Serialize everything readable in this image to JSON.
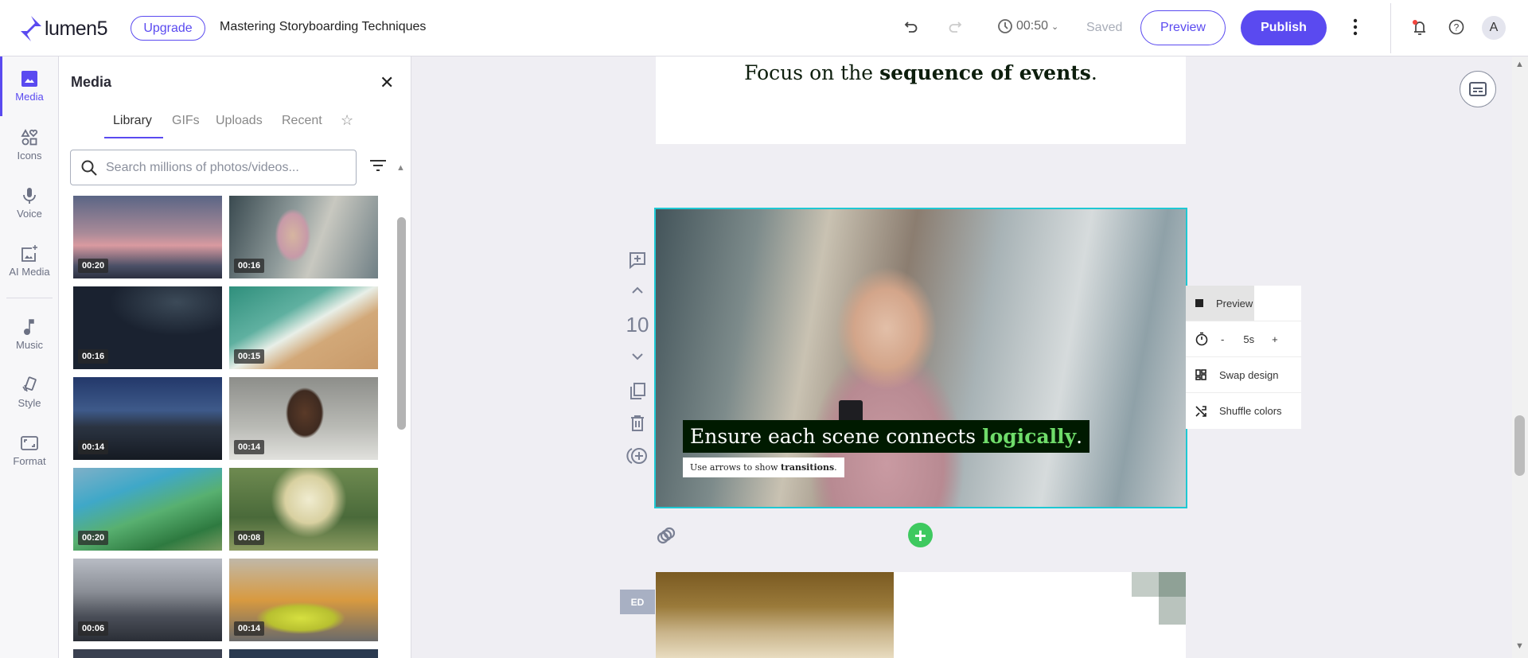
{
  "header": {
    "logo_text": "lumen5",
    "upgrade_label": "Upgrade",
    "project_title": "Mastering Storyboarding Techniques",
    "duration": "00:50",
    "save_status": "Saved",
    "preview_label": "Preview",
    "publish_label": "Publish",
    "avatar_initial": "A"
  },
  "rail": {
    "items": [
      {
        "label": "Media",
        "icon": "image-icon"
      },
      {
        "label": "Icons",
        "icon": "shapes-icon"
      },
      {
        "label": "Voice",
        "icon": "microphone-icon"
      },
      {
        "label": "AI Media",
        "icon": "ai-image-icon"
      },
      {
        "label": "Music",
        "icon": "music-note-icon"
      },
      {
        "label": "Style",
        "icon": "style-icon"
      },
      {
        "label": "Format",
        "icon": "format-icon"
      }
    ]
  },
  "panel": {
    "title": "Media",
    "tabs": [
      "Library",
      "GIFs",
      "Uploads",
      "Recent"
    ],
    "search_placeholder": "Search millions of photos/videos...",
    "thumbnails": [
      {
        "duration": "00:20"
      },
      {
        "duration": "00:16"
      },
      {
        "duration": "00:16"
      },
      {
        "duration": "00:15"
      },
      {
        "duration": "00:14"
      },
      {
        "duration": "00:14"
      },
      {
        "duration": "00:20"
      },
      {
        "duration": "00:08"
      },
      {
        "duration": "00:06"
      },
      {
        "duration": "00:14"
      }
    ]
  },
  "scenes": {
    "prev_text_plain": "Focus on the ",
    "prev_text_bold": "sequence of events",
    "prev_text_end": ".",
    "current_number": "10",
    "caption_plain": "Ensure each scene connects ",
    "caption_highlight": "logically",
    "caption_end": ".",
    "sub_plain": "Use arrows to show ",
    "sub_bold": "transitions",
    "sub_end": ".",
    "next_badge": "ED"
  },
  "scene_menu": {
    "preview_label": "Preview",
    "duration_minus": "-",
    "duration_value": "5s",
    "duration_plus": "+",
    "swap_label": "Swap design",
    "shuffle_label": "Shuffle colors"
  },
  "colors": {
    "accent": "#5a4af0",
    "selection": "#1ec8d3",
    "add": "#3ec95f",
    "caption_bg": "#001a00",
    "caption_highlight": "#6fdc6a"
  }
}
